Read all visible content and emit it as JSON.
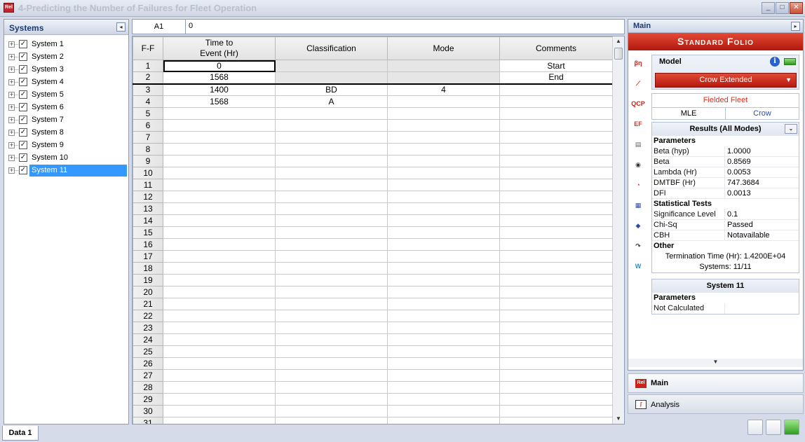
{
  "window": {
    "title": "4-Predicting the Number of Failures for Fleet Operation",
    "app_icon": "Rel"
  },
  "systems_panel": {
    "title": "Systems",
    "items": [
      "System 1",
      "System 2",
      "System 3",
      "System 4",
      "System 5",
      "System 6",
      "System 7",
      "System 8",
      "System 9",
      "System 10",
      "System 11"
    ],
    "selected_index": 10
  },
  "cell_bar": {
    "ref": "A1",
    "value": "0"
  },
  "worksheet": {
    "columns": [
      "F-F",
      "Time to\nEvent (Hr)",
      "Classification",
      "Mode",
      "Comments"
    ],
    "rows": [
      {
        "n": "1",
        "time": "0",
        "cls": "",
        "mode": "",
        "comment": "Start"
      },
      {
        "n": "2",
        "time": "1568",
        "cls": "",
        "mode": "",
        "comment": "End"
      },
      {
        "n": "3",
        "time": "1400",
        "cls": "BD",
        "mode": "4",
        "comment": ""
      },
      {
        "n": "4",
        "time": "1568",
        "cls": "A",
        "mode": "",
        "comment": ""
      },
      {
        "n": "5"
      },
      {
        "n": "6"
      },
      {
        "n": "7"
      },
      {
        "n": "8"
      },
      {
        "n": "9"
      },
      {
        "n": "10"
      },
      {
        "n": "11"
      },
      {
        "n": "12"
      },
      {
        "n": "13"
      },
      {
        "n": "14"
      },
      {
        "n": "15"
      },
      {
        "n": "16"
      },
      {
        "n": "17"
      },
      {
        "n": "18"
      },
      {
        "n": "19"
      },
      {
        "n": "20"
      },
      {
        "n": "21"
      },
      {
        "n": "22"
      },
      {
        "n": "23"
      },
      {
        "n": "24"
      },
      {
        "n": "25"
      },
      {
        "n": "26"
      },
      {
        "n": "27"
      },
      {
        "n": "28"
      },
      {
        "n": "29"
      },
      {
        "n": "30"
      },
      {
        "n": "31"
      }
    ]
  },
  "sheet_tabs": [
    "Data 1"
  ],
  "right_panel": {
    "header": "Main",
    "banner": "Standard Folio",
    "model": {
      "label": "Model",
      "value": "Crow Extended"
    },
    "fleet": {
      "title": "Fielded Fleet",
      "options": [
        "MLE",
        "Crow"
      ]
    },
    "results": {
      "title": "Results (All Modes)",
      "parameters_label": "Parameters",
      "parameters": [
        {
          "k": "Beta (hyp)",
          "v": "1.0000"
        },
        {
          "k": "Beta",
          "v": "0.8569"
        },
        {
          "k": "Lambda (Hr)",
          "v": "0.0053"
        },
        {
          "k": "DMTBF (Hr)",
          "v": "747.3684"
        },
        {
          "k": "DFI",
          "v": "0.0013"
        }
      ],
      "tests_label": "Statistical Tests",
      "tests": [
        {
          "k": "Significance Level",
          "v": "0.1"
        },
        {
          "k": "Chi-Sq",
          "v": "Passed"
        },
        {
          "k": "CBH",
          "v": "Notavailable"
        }
      ],
      "other_label": "Other",
      "other": [
        "Termination Time (Hr): 1.4200E+04",
        "Systems: 11/11"
      ]
    },
    "system_box": {
      "title": "System 11",
      "parameters_label": "Parameters",
      "note": "Not Calculated"
    },
    "tools": [
      "beta-icon",
      "line-plot-icon",
      "qcp-icon",
      "ef-icon",
      "calc-icon",
      "camera-icon",
      "gauge-icon",
      "graph-icon",
      "diamond-icon",
      "redo-icon",
      "weibull-icon"
    ]
  },
  "nav": {
    "main": "Main",
    "analysis": "Analysis"
  },
  "colors": {
    "accent_red": "#c8241a",
    "selection_blue": "#3399ff",
    "link_blue": "#2c4aa8"
  }
}
